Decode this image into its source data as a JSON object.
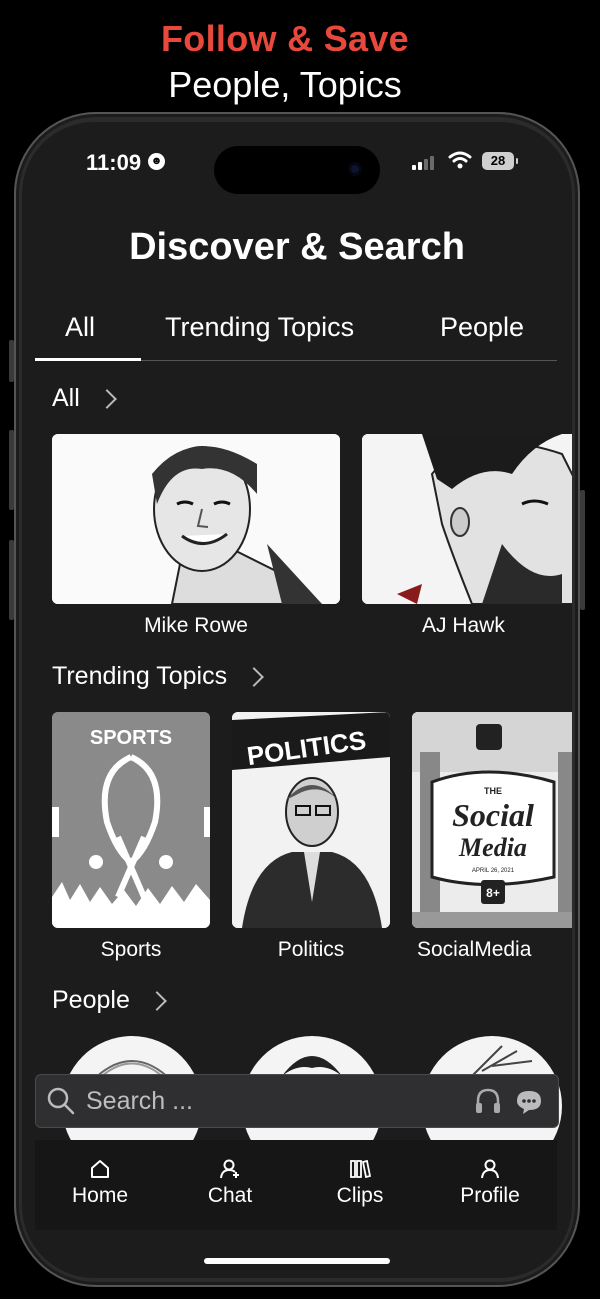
{
  "promo": {
    "title": "Follow & Save",
    "subtitle": "People, Topics"
  },
  "status_bar": {
    "time": "11:09",
    "battery": "28",
    "signal_bars": 2
  },
  "page": {
    "title": "Discover & Search"
  },
  "tabs": [
    {
      "label": "All",
      "active": true
    },
    {
      "label": "Trending Topics",
      "active": false
    },
    {
      "label": "People",
      "active": false
    }
  ],
  "sections": {
    "all": {
      "header": "All",
      "cards": [
        {
          "label": "Mike Rowe"
        },
        {
          "label": "AJ Hawk"
        }
      ]
    },
    "trending": {
      "header": "Trending Topics",
      "cards": [
        {
          "label": "Sports",
          "art_text": "SPORTS"
        },
        {
          "label": "Politics",
          "art_text": "POLITICS"
        },
        {
          "label": "SocialMedia",
          "art_text_1": "THE",
          "art_text_2": "Social",
          "art_text_3": "Media",
          "art_text_4": "APRIL 26, 2021",
          "art_text_5": "8+"
        }
      ]
    },
    "people": {
      "header": "People"
    }
  },
  "search": {
    "placeholder": "Search ..."
  },
  "bottom_nav": [
    {
      "label": "Home",
      "icon": "home-icon"
    },
    {
      "label": "Chat",
      "icon": "chat-person-icon"
    },
    {
      "label": "Clips",
      "icon": "clips-icon"
    },
    {
      "label": "Profile",
      "icon": "profile-icon"
    }
  ],
  "colors": {
    "accent": "#e8493c",
    "background": "#1c1c1c",
    "nav_background": "#161616"
  }
}
